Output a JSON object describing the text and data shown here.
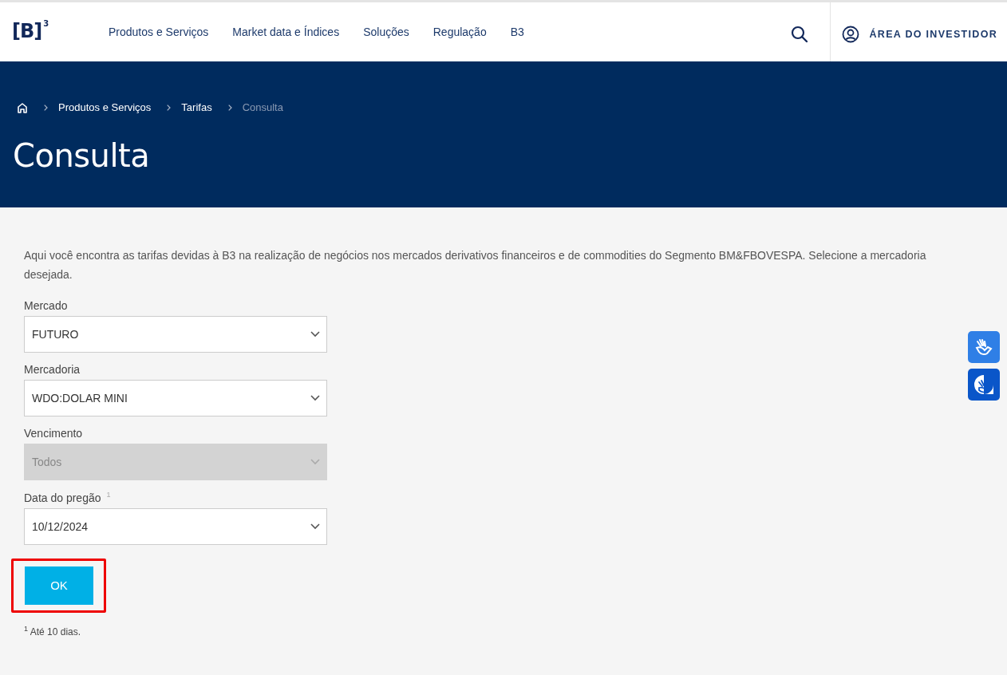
{
  "header": {
    "logo": "[B]$^{3}$",
    "nav": [
      "Produtos e Serviços",
      "Market data e Índices",
      "Soluções",
      "Regulação",
      "B3"
    ],
    "investor_link": "ÁREA DO INVESTIDOR"
  },
  "hero": {
    "breadcrumb": [
      {
        "label": "Produtos e Serviços",
        "current": false
      },
      {
        "label": "Tarifas",
        "current": false
      },
      {
        "label": "Consulta",
        "current": true
      }
    ],
    "title": "Consulta"
  },
  "intro": "Aqui você encontra as tarifas devidas à B3 na realização de negócios nos mercados derivativos financeiros e de commodities do Segmento BM&FBOVESPA. Selecione a mercadoria desejada.",
  "form": {
    "fields": [
      {
        "kind": "select",
        "label": "Mercado",
        "value": "FUTURO",
        "disabled": false
      },
      {
        "kind": "select",
        "label": "Mercadoria",
        "value": "WDO:DOLAR MINI",
        "disabled": false
      },
      {
        "kind": "select",
        "label": "Vencimento",
        "value": "Todos",
        "disabled": true
      },
      {
        "kind": "select",
        "label": "Data do pregão $^{1}$",
        "value": "10/12/2024",
        "disabled": false
      }
    ],
    "submit": {
      "label": "OK",
      "highlighted": true
    },
    "footnote": "$^{1}$ Até 10 dias."
  }
}
